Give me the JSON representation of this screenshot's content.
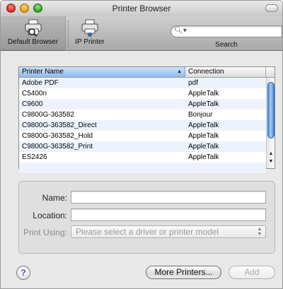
{
  "window": {
    "title": "Printer Browser"
  },
  "toolbar": {
    "default_browser_label": "Default Browser",
    "ip_printer_label": "IP Printer",
    "search_label": "Search",
    "search_placeholder": ""
  },
  "printer_list": {
    "columns": {
      "name": "Printer Name",
      "connection": "Connection"
    },
    "rows": [
      {
        "name": "Adobe PDF",
        "connection": "pdf"
      },
      {
        "name": "C5400n",
        "connection": "AppleTalk"
      },
      {
        "name": "C9600",
        "connection": "AppleTalk"
      },
      {
        "name": "C9800G-363582",
        "connection": "Bonjour"
      },
      {
        "name": "C9800G-363582_Direct",
        "connection": "AppleTalk"
      },
      {
        "name": "C9800G-363582_Hold",
        "connection": "AppleTalk"
      },
      {
        "name": "C9800G-363582_Print",
        "connection": "AppleTalk"
      },
      {
        "name": "ES2426",
        "connection": "AppleTalk"
      }
    ]
  },
  "details": {
    "name_label": "Name:",
    "name_value": "",
    "location_label": "Location:",
    "location_value": "",
    "print_using_label": "Print Using:",
    "print_using_value": "Please select a driver or printer model"
  },
  "buttons": {
    "help": "?",
    "more_printers": "More Printers...",
    "add": "Add"
  }
}
